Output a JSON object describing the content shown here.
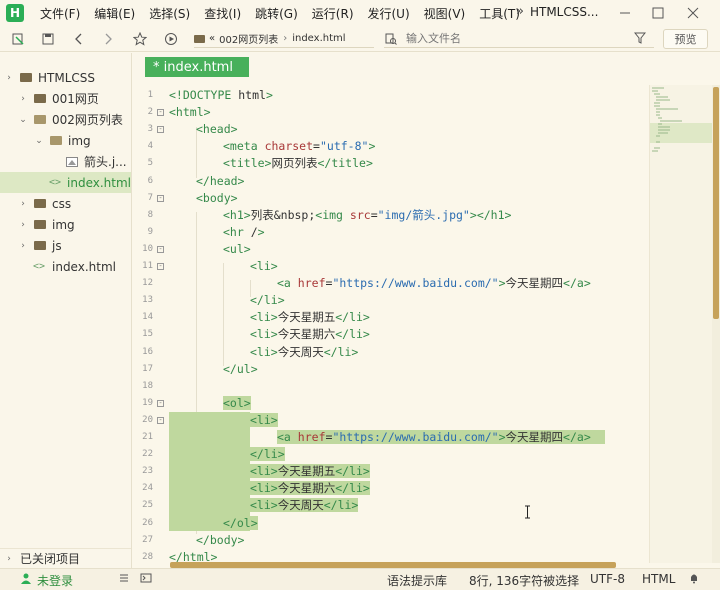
{
  "app": {
    "logo": "H",
    "title": "HTMLCSS..."
  },
  "menu": [
    "文件(F)",
    "编辑(E)",
    "选择(S)",
    "查找(I)",
    "跳转(G)",
    "运行(R)",
    "发行(U)",
    "视图(V)",
    "工具(T)"
  ],
  "toolbar": {
    "breadcrumb_sep": "«",
    "breadcrumb": [
      "002网页列表",
      "index.html"
    ],
    "file_search_placeholder": "输入文件名",
    "preview_label": "预览"
  },
  "sidebar": {
    "items": [
      {
        "label": "HTMLCSS",
        "chev": "›",
        "icon": "folder"
      },
      {
        "label": "001网页",
        "chev": "›",
        "icon": "folder"
      },
      {
        "label": "002网页列表",
        "chev": "⌄",
        "icon": "folder"
      },
      {
        "label": "img",
        "chev": "⌄",
        "icon": "folder-open"
      },
      {
        "label": "箭头.j...",
        "chev": "",
        "icon": "image"
      },
      {
        "label": "index.html",
        "chev": "",
        "icon": "code"
      },
      {
        "label": "css",
        "chev": "›",
        "icon": "folder"
      },
      {
        "label": "img",
        "chev": "›",
        "icon": "folder"
      },
      {
        "label": "js",
        "chev": "›",
        "icon": "folder"
      },
      {
        "label": "index.html",
        "chev": "",
        "icon": "code"
      }
    ],
    "closed_projects": "已关闭项目"
  },
  "tab": {
    "label": "* index.html"
  },
  "editor": {
    "line_numbers": [
      "1",
      "2",
      "3",
      "4",
      "5",
      "6",
      "7",
      "8",
      "9",
      "10",
      "11",
      "12",
      "13",
      "14",
      "15",
      "16",
      "17",
      "18",
      "19",
      "20",
      "21",
      "22",
      "23",
      "24",
      "25",
      "26",
      "27",
      "28"
    ],
    "fold_marker": "⊟",
    "lines": [
      "<!DOCTYPE html>",
      "<html>",
      "<head>",
      "<meta charset=\"utf-8\">",
      "<title>网页列表</title>",
      "</head>",
      "<body>",
      "<h1>列表&nbsp;<img src=\"img/箭头.jpg\"></h1>",
      "<hr />",
      "<ul>",
      "<li>",
      "<a href=\"https://www.baidu.com/\">今天星期四</a>",
      "</li>",
      "<li>今天星期五</li>",
      "<li>今天星期六</li>",
      "<li>今天周天</li>",
      "</ul>",
      "",
      "<ol>",
      "<li>",
      "<a href=\"https://www.baidu.com/\">今天星期四</a>",
      "</li>",
      "<li>今天星期五</li>",
      "<li>今天星期六</li>",
      "<li>今天周天</li>",
      "</ol>",
      "</body>",
      "</html>"
    ]
  },
  "status": {
    "login": "未登录",
    "syntax_lib": "语法提示库",
    "selection": "8行, 136字符被选择",
    "encoding": "UTF-8",
    "language": "HTML"
  },
  "colors": {
    "accent": "#48b05b",
    "selection": "#bfd89e",
    "scrollbar": "#c6a25a"
  }
}
